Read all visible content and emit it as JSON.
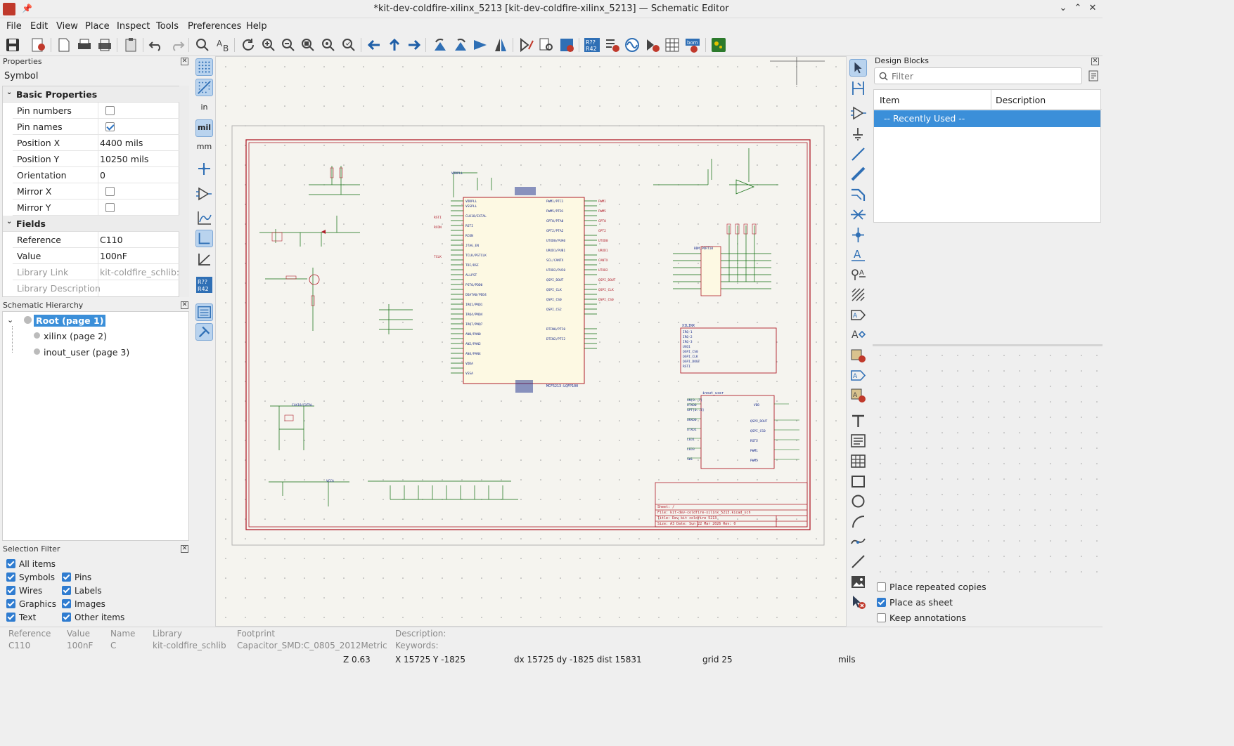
{
  "window": {
    "title": "*kit-dev-coldfire-xilinx_5213 [kit-dev-coldfire-xilinx_5213] — Schematic Editor"
  },
  "menu": [
    "File",
    "Edit",
    "View",
    "Place",
    "Inspect",
    "Tools",
    "Preferences",
    "Help"
  ],
  "properties": {
    "header": "Properties",
    "type": "Symbol",
    "basic_title": "Basic Properties",
    "rows": [
      {
        "label": "Pin numbers",
        "value": "",
        "checked": false
      },
      {
        "label": "Pin names",
        "value": "",
        "checked": true
      },
      {
        "label": "Position X",
        "value": "4400 mils"
      },
      {
        "label": "Position Y",
        "value": "10250 mils"
      },
      {
        "label": "Orientation",
        "value": "0"
      },
      {
        "label": "Mirror X",
        "value": "",
        "checked": false
      },
      {
        "label": "Mirror Y",
        "value": "",
        "checked": false
      }
    ],
    "fields_title": "Fields",
    "fields": [
      {
        "label": "Reference",
        "value": "C110"
      },
      {
        "label": "Value",
        "value": "100nF"
      },
      {
        "label": "Library Link",
        "value": "kit-coldfire_schlib:C"
      },
      {
        "label": "Library Description",
        "value": ""
      }
    ]
  },
  "hierarchy": {
    "header": "Schematic Hierarchy",
    "items": [
      "Root (page 1)",
      "xilinx (page 2)",
      "inout_user (page 3)"
    ]
  },
  "selection_filter": {
    "header": "Selection Filter",
    "all": "All items",
    "left": [
      "Symbols",
      "Wires",
      "Graphics",
      "Text"
    ],
    "right": [
      "Pins",
      "Labels",
      "Images",
      "Other items"
    ]
  },
  "lefttools": {
    "in": "in",
    "mil": "mil",
    "mm": "mm",
    "annot": "R??\nR42"
  },
  "righttools": {
    "annot": "R??\nR42"
  },
  "design_blocks": {
    "header": "Design Blocks",
    "filter_placeholder": "Filter",
    "col_item": "Item",
    "col_desc": "Description",
    "recent": "-- Recently Used --",
    "opt_repeat": "Place repeated copies",
    "opt_sheet": "Place as sheet",
    "opt_annot": "Keep annotations"
  },
  "schematic": {
    "title_block": [
      "Sheet: /",
      "File: kit-dev-coldfire-xilinx_5213.kicad_sch",
      "Title: Dev kit coldfire 5213",
      "Size: A3   Date: Sun 22 Mar 2026   Rev: 0",
      "KiCad E.D.A. 10.0.0-rc2-125-g9b0f9b0a6   Id: 1/3"
    ],
    "labels": [
      "XILINX",
      "inout_user",
      "MCF5213-LQFP100",
      "CLK18/EXTAL",
      "VCCA",
      "VDDPLL",
      "BDM_PORT10"
    ]
  },
  "status": {
    "ref_lbl": "Reference",
    "ref": "C110",
    "val_lbl": "Value",
    "val": "100nF",
    "name_lbl": "Name",
    "name": "C",
    "lib_lbl": "Library",
    "lib": "kit-coldfire_schlib",
    "fp_lbl": "Footprint",
    "fp": "Capacitor_SMD:C_0805_2012Metric",
    "desc_lbl": "Description:",
    "kw_lbl": "Keywords:",
    "zoom": "Z 0.63",
    "xy": "X 15725  Y -1825",
    "dxy": "dx 15725  dy -1825  dist 15831",
    "grid": "grid 25",
    "units": "mils"
  }
}
